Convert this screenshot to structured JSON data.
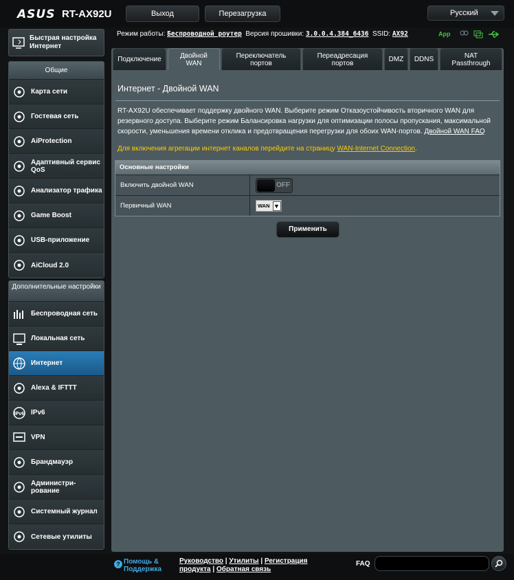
{
  "header": {
    "brand": "ASUS",
    "model": "RT-AX92U",
    "logout_label": "Выход",
    "reboot_label": "Перезагрузка",
    "language": "Русский"
  },
  "status": {
    "mode_label": "Режим работы:",
    "mode_value": "Беспроводной роутер",
    "fw_label": "Версия прошивки:",
    "fw_value": "3.0.0.4.384_6436",
    "ssid_label": "SSID:",
    "ssid_value": "AX92",
    "app_label": "App"
  },
  "sidebar": {
    "quick_setup": "Быстрая настройка Интернет",
    "general_header": "Общие",
    "general": [
      {
        "label": "Карта сети",
        "icon": "network-map-icon"
      },
      {
        "label": "Гостевая сеть",
        "icon": "guest-network-icon"
      },
      {
        "label": "AiProtection",
        "icon": "aiprotection-icon"
      },
      {
        "label": "Адаптивный сервис QoS",
        "icon": "qos-icon"
      },
      {
        "label": "Анализатор трафика",
        "icon": "traffic-analyzer-icon"
      },
      {
        "label": "Game Boost",
        "icon": "gamepad-icon"
      },
      {
        "label": "USB-приложение",
        "icon": "usb-icon"
      },
      {
        "label": "AiCloud 2.0",
        "icon": "aicloud-icon"
      }
    ],
    "advanced_header": "Дополнительные настройки",
    "advanced": [
      {
        "label": "Беспроводная сеть",
        "icon": "wireless-icon"
      },
      {
        "label": "Локальная сеть",
        "icon": "lan-icon"
      },
      {
        "label": "Интернет",
        "icon": "globe-icon",
        "active": true
      },
      {
        "label": "Alexa & IFTTT",
        "icon": "alexa-icon"
      },
      {
        "label": "IPv6",
        "icon": "ipv6-icon"
      },
      {
        "label": "VPN",
        "icon": "vpn-icon"
      },
      {
        "label": "Брандмауэр",
        "icon": "firewall-icon"
      },
      {
        "label": "Администри-рование",
        "icon": "admin-icon"
      },
      {
        "label": "Системный журнал",
        "icon": "syslog-icon"
      },
      {
        "label": "Сетевые утилиты",
        "icon": "network-tools-icon"
      }
    ]
  },
  "tabs": [
    "Подключение",
    "Двойной WAN",
    "Переключатель портов",
    "Переадресация портов",
    "DMZ",
    "DDNS",
    "NAT Passthrough"
  ],
  "panel": {
    "title": "Интернет - Двойной WAN",
    "description": "RT-AX92U обеспечивает поддержку двойного WAN. Выберите режим Отказоустойчивость вторичного WAN для резервного доступа. Выберите режим Балансировка нагрузки для оптимизации полосы пропускания, максимальной скорости, уменьшения времени отклика и предотвращения перегрузки для обоих WAN-портов.",
    "faq_link": "Двойной WAN FAQ",
    "note_text": "Для включения агрегации интернет каналов перейдите на страницу",
    "note_link": "WAN-Internet Connection",
    "table_header": "Основные настройки",
    "enable_label": "Включить двойной WAN",
    "toggle_state": "OFF",
    "primary_label": "Первичный WAN",
    "primary_value": "WAN",
    "apply_label": "Применить"
  },
  "footer": {
    "help_line1": "Помощь &",
    "help_line2": "Поддержка",
    "manual": "Руководство",
    "utilities": "Утилиты",
    "registration": "Регистрация",
    "product": "продукта",
    "feedback": "Обратная связь",
    "faq": "FAQ"
  }
}
